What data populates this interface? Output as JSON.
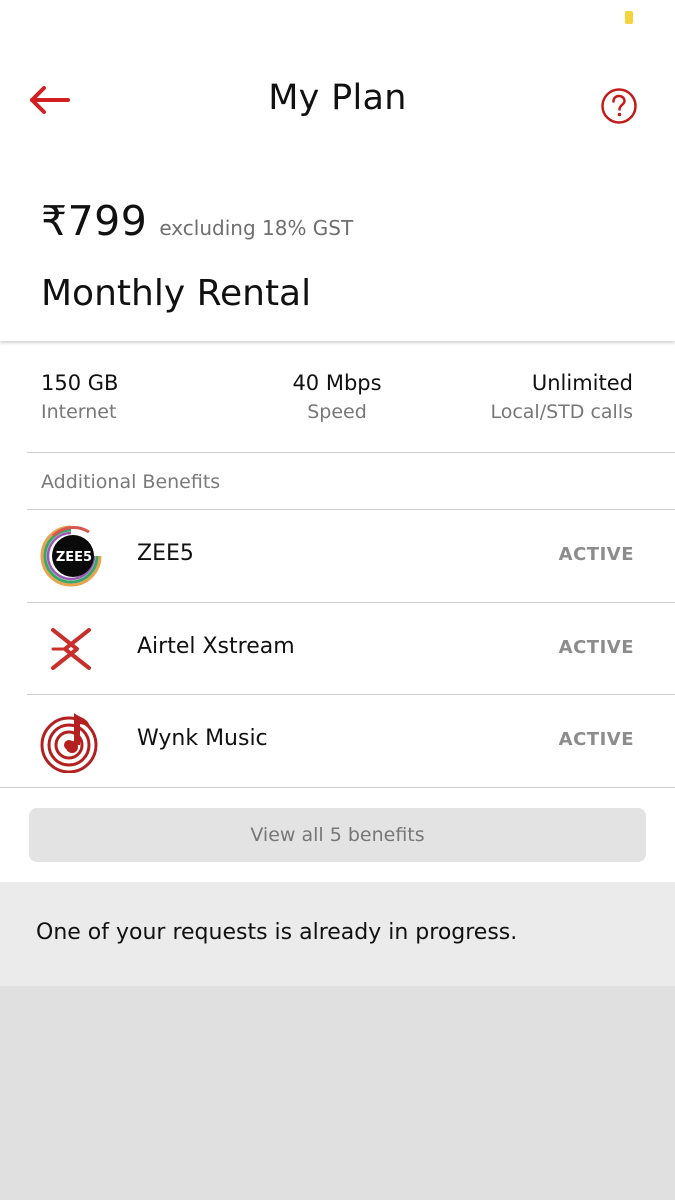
{
  "header": {
    "title": "My Plan"
  },
  "plan": {
    "price": "₹799",
    "price_note": "excluding 18% GST",
    "type": "Monthly Rental"
  },
  "stats": [
    {
      "value": "150 GB",
      "label": "Internet"
    },
    {
      "value": "40 Mbps",
      "label": "Speed"
    },
    {
      "value": "Unlimited",
      "label": "Local/STD calls"
    }
  ],
  "benefits": {
    "heading": "Additional Benefits",
    "items": [
      {
        "name": "ZEE5",
        "status": "ACTIVE",
        "icon": "zee5-logo-icon",
        "logo_text": "ZEE5"
      },
      {
        "name": "Airtel Xstream",
        "status": "ACTIVE",
        "icon": "airtel-xstream-logo-icon"
      },
      {
        "name": "Wynk Music",
        "status": "ACTIVE",
        "icon": "wynk-music-logo-icon"
      }
    ],
    "view_all_label": "View all 5 benefits"
  },
  "notice": {
    "text": "One of your requests is already in progress."
  },
  "colors": {
    "accent": "#d0201f",
    "status_dot": "#f5d33a"
  }
}
